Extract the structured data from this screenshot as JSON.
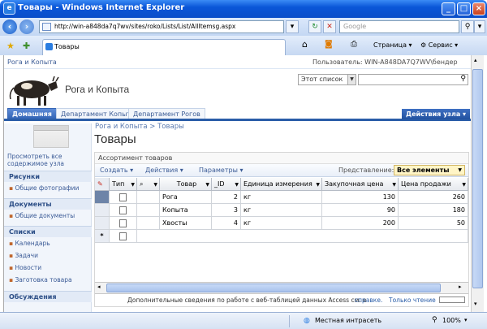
{
  "window": {
    "title": "Товары - Windows Internet Explorer"
  },
  "address": {
    "url": "http://win-a848da7q7wv/sites/roko/Lists/List/AllItemsg.aspx",
    "search_placeholder": "Google"
  },
  "tabs": {
    "tab1": "Товары",
    "page_menu": "Страница",
    "service_menu": "Сервис"
  },
  "site": {
    "top_link": "Рога и Копыта",
    "user": "Пользователь: WIN-A848DA7Q7WV\\бендер",
    "title": "Рога и Копыта",
    "search_scope": "Этот список",
    "nav_tabs": [
      "Домашняя",
      "Департамент Копыт",
      "Департамент Рогов"
    ],
    "site_actions": "Действия узла"
  },
  "leftnav": {
    "view_all": "Просмотреть все содержимое узла",
    "sections": [
      {
        "title": "Рисунки",
        "items": [
          "Общие фотографии"
        ]
      },
      {
        "title": "Документы",
        "items": [
          "Общие документы"
        ]
      },
      {
        "title": "Списки",
        "items": [
          "Календарь",
          "Задачи",
          "Новости",
          "Заготовка товара"
        ]
      },
      {
        "title": "Обсуждения",
        "items": []
      }
    ]
  },
  "main": {
    "breadcrumb": "Рога и Копыта > Товары",
    "page_title": "Товары",
    "webpart_title": "Ассортимент товаров",
    "toolbar": {
      "create": "Создать",
      "actions": "Действия",
      "settings": "Параметры",
      "view_label": "Представление:",
      "view_value": "Все элементы"
    },
    "columns": [
      "Тип",
      "Товар",
      "_ID",
      "Единица измерения",
      "Закупочная цена",
      "Цена продажи"
    ],
    "rows": [
      {
        "name": "Рога",
        "id": "2",
        "unit": "кг",
        "buy": "130",
        "sell": "260"
      },
      {
        "name": "Копыта",
        "id": "3",
        "unit": "кг",
        "buy": "90",
        "sell": "180"
      },
      {
        "name": "Хвосты",
        "id": "4",
        "unit": "кг",
        "buy": "200",
        "sell": "50"
      }
    ],
    "new_row_marker": "*",
    "status_text": "Дополнительные сведения по работе с веб-таблицей данных Access см. в",
    "status_link": "справке.",
    "readonly": "Только чтение"
  },
  "statusbar": {
    "zone": "Местная интрасеть",
    "zoom": "100%"
  },
  "colors": {
    "ie_blue": "#0a56d8",
    "sp_blue": "#2a5da8",
    "view_yellow": "#fff5c6"
  }
}
